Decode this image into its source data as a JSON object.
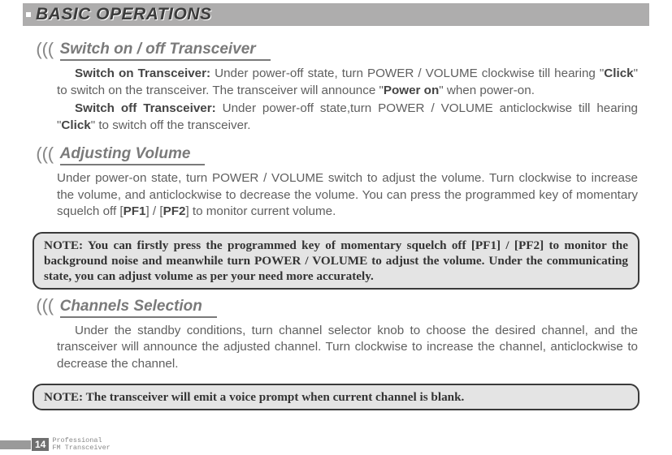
{
  "banner": {
    "title": "BASIC OPERATIONS"
  },
  "sections": {
    "switch": {
      "title": "Switch on / off Transceiver",
      "p1_lead": "Switch on Transceiver:",
      "p1_text_a": " Under power-off state, turn POWER / VOLUME clockwise till hearing \"",
      "p1_bold1": "Click",
      "p1_text_b": "\" to switch on the transceiver. The transceiver will announce \"",
      "p1_bold2": "Power on",
      "p1_text_c": "\" when power-on.",
      "p2_lead": "Switch off Transceiver:",
      "p2_text_a": " Under power-off state,turn POWER / VOLUME anticlockwise till hearing \"",
      "p2_bold1": "Click",
      "p2_text_b": "\" to switch off the transceiver."
    },
    "volume": {
      "title": "Adjusting Volume",
      "p1_a": "Under power-on state, turn POWER / VOLUME switch to adjust the volume. Turn clockwise to increase the volume, and anticlockwise to decrease the volume. You can press the programmed key of momentary squelch off [",
      "p1_b1": "PF1",
      "p1_mid": "] / [",
      "p1_b2": "PF2",
      "p1_c": "] to monitor current volume.",
      "note": "NOTE: You can firstly press the programmed key of momentary squelch off [PF1] / [PF2] to monitor the background noise and meanwhile turn POWER / VOLUME to adjust the volume. Under the communicating state, you can adjust volume as per your need more accurately."
    },
    "channels": {
      "title": "Channels Selection",
      "p1": "Under the standby conditions, turn channel selector knob to choose the desired channel, and the transceiver will announce the adjusted channel. Turn clockwise to increase the channel, anticlockwise to decrease the channel.",
      "note": "NOTE: The transceiver will emit a voice prompt when current channel is blank."
    }
  },
  "footer": {
    "page": "14",
    "line1": "Professional",
    "line2": "FM Transceiver"
  }
}
